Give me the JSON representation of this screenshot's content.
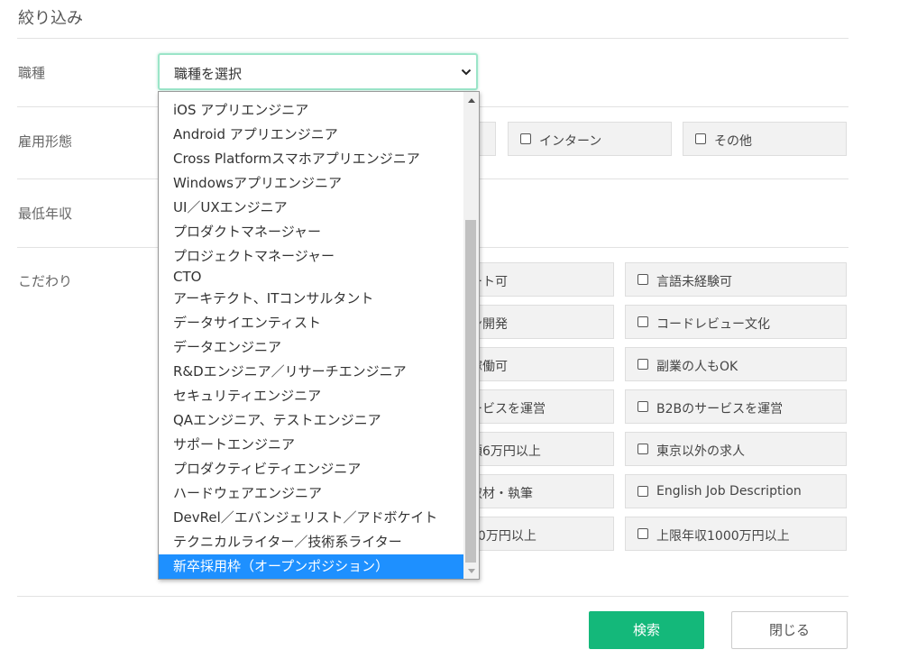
{
  "panel": {
    "title": "絞り込み"
  },
  "rows": {
    "job_type": "職種",
    "employment": "雇用形態",
    "min_salary": "最低年収",
    "preferences": "こだわり"
  },
  "job_select": {
    "value": "職種を選択",
    "options_visible": [
      "iOS アプリエンジニア",
      "Android アプリエンジニア",
      "Cross Platformスマホアプリエンジニア",
      "Windowsアプリエンジニア",
      "UI／UXエンジニア",
      "プロダクトマネージャー",
      "プロジェクトマネージャー",
      "CTO",
      "アーキテクト、ITコンサルタント",
      "データサイエンティスト",
      "データエンジニア",
      "R&Dエンジニア／リサーチエンジニア",
      "セキュリティエンジニア",
      "QAエンジニア、テストエンジニア",
      "サポートエンジニア",
      "プロダクティビティエンジニア",
      "ハードウェアエンジニア",
      "DevRel／エバンジェリスト／アドボケイト",
      "テクニカルライター／技術系ライター",
      "新卒採用枠（オープンポジション）"
    ],
    "selected_index": 19
  },
  "employment_options": {
    "intern": "インターン",
    "other": "その他"
  },
  "preference_partial": [
    "ート可",
    "ン開発",
    "稼働可",
    "ービスを運営",
    "額6万円以上",
    "取材・執筆",
    "00万円以上"
  ],
  "preference_options": [
    "言語未経験可",
    "コードレビュー文化",
    "副業の人もOK",
    "B2Bのサービスを運営",
    "東京以外の求人",
    "English Job Description",
    "上限年収1000万円以上"
  ],
  "buttons": {
    "search": "検索",
    "close": "閉じる"
  },
  "colors": {
    "accent": "#14b87a",
    "select_focus": "#9be5c8",
    "selected_option": "#1e90ff"
  }
}
